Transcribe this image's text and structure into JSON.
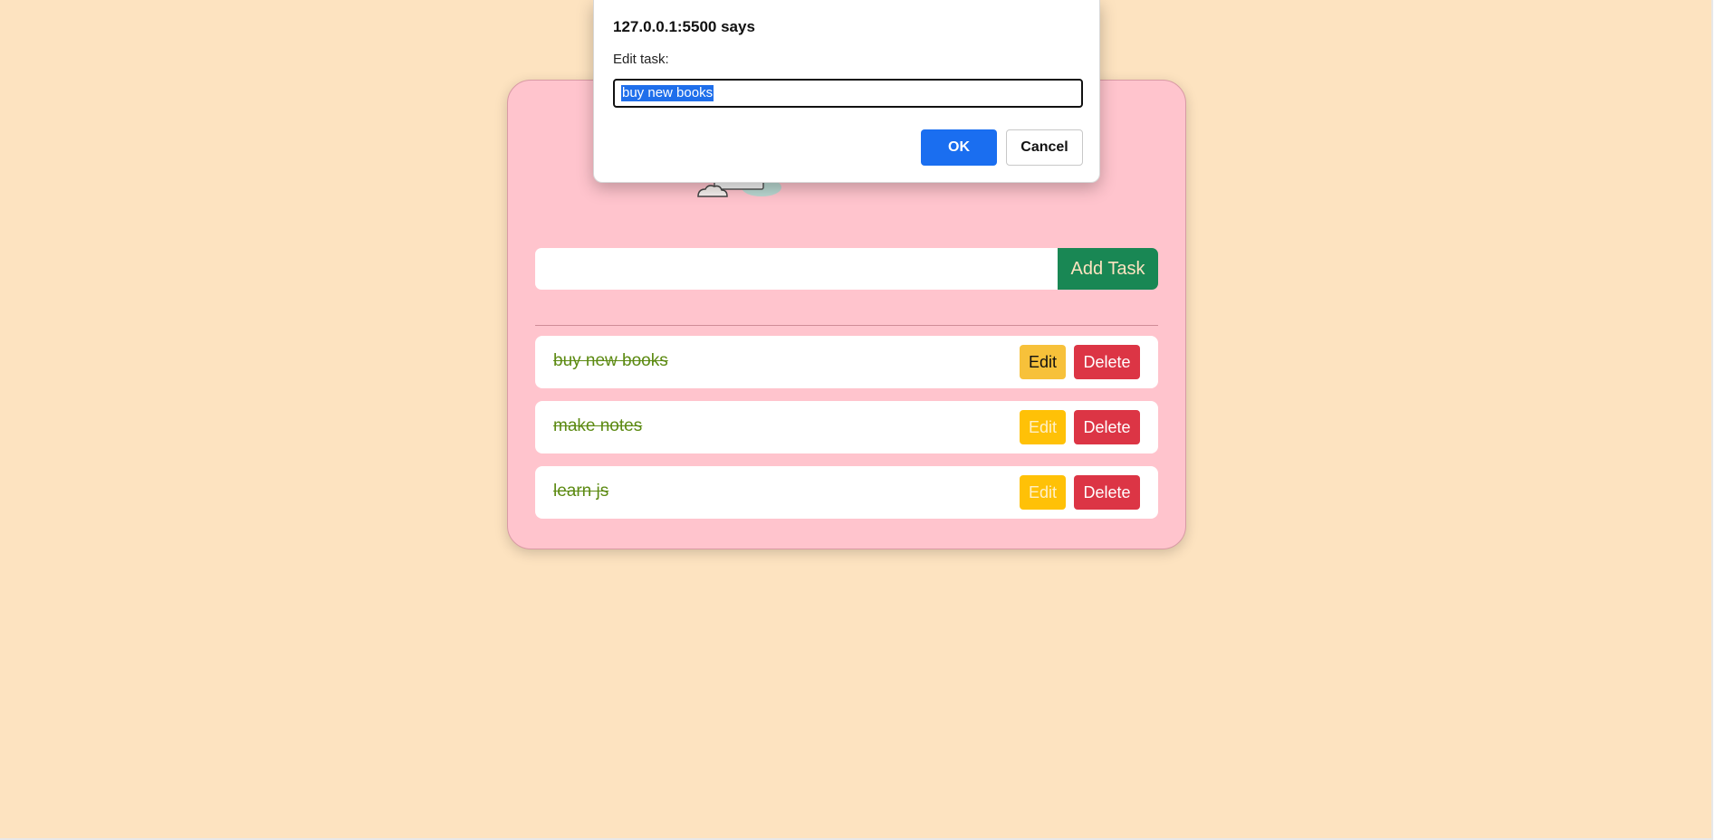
{
  "dialog": {
    "title": "127.0.0.1:5500 says",
    "message": "Edit task:",
    "input_value": "buy new books",
    "ok_label": "OK",
    "cancel_label": "Cancel"
  },
  "todo": {
    "input_value": "",
    "add_label": "Add Task",
    "illustration_icon": "notebook-cloud-icon",
    "tasks": [
      {
        "text": "buy new books",
        "completed": true,
        "edit_label": "Edit",
        "delete_label": "Delete"
      },
      {
        "text": "make notes",
        "completed": true,
        "edit_label": "Edit",
        "delete_label": "Delete"
      },
      {
        "text": "learn js",
        "completed": true,
        "edit_label": "Edit",
        "delete_label": "Delete"
      }
    ]
  },
  "colors": {
    "page_background": "#fde3c0",
    "card_background": "#ffc4cd",
    "add_button": "#198754",
    "edit_button": "#ffc107",
    "delete_button": "#dc3545",
    "ok_button": "#1a6ef0",
    "completed_text": "#5c8a12",
    "selection": "#1f6feb"
  }
}
